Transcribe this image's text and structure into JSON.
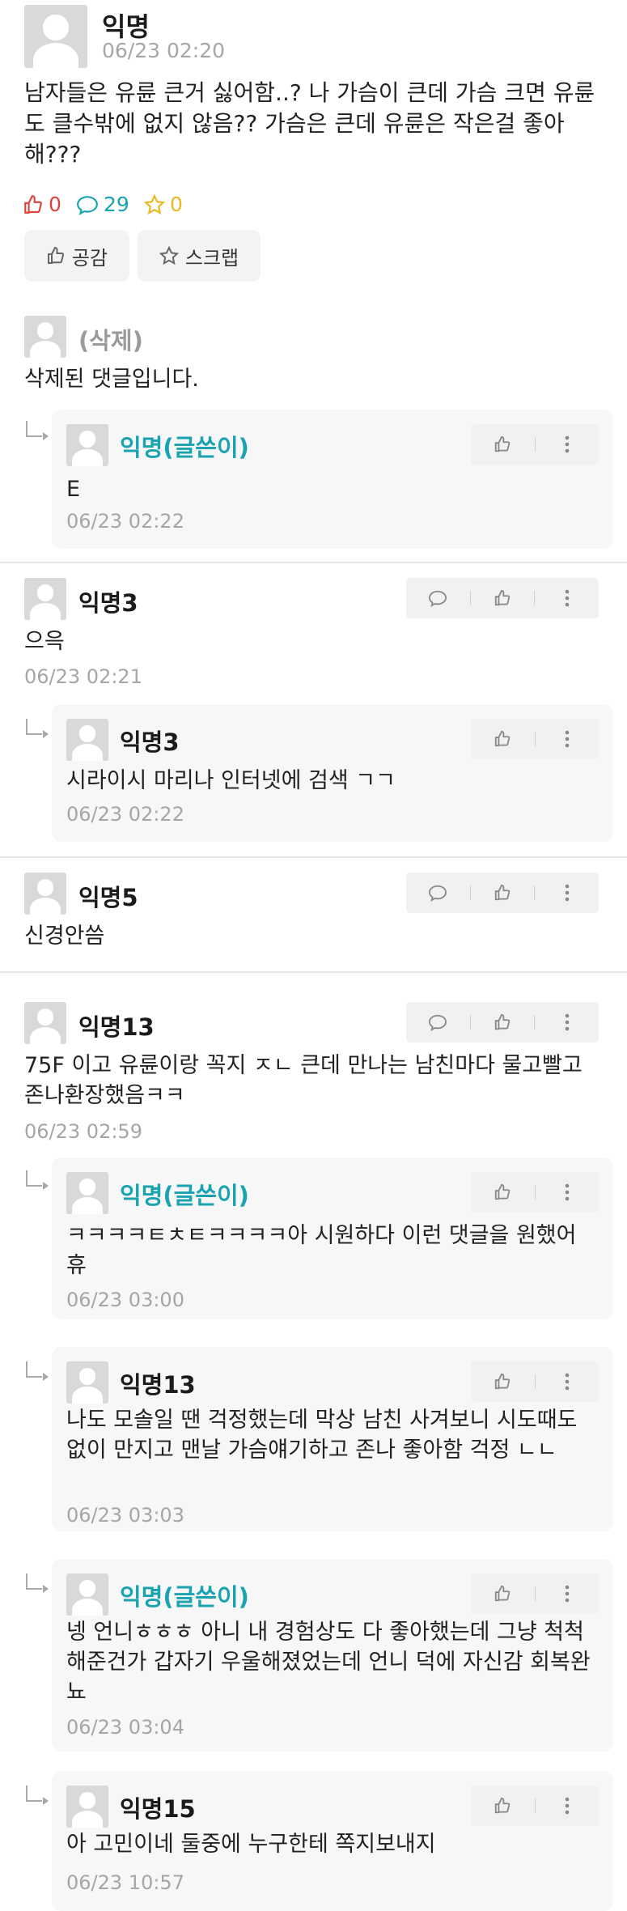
{
  "post": {
    "author": "익명",
    "date": "06/23 02:20",
    "body": "남자들은 유륜 큰거 싫어함..? 나 가슴이 큰데 가슴 크면 유륜도 클수밖에 없지 않음?? 가슴은 큰데 유륜은 작은걸 좋아해???",
    "likes": "0",
    "comments": "29",
    "scraps": "0",
    "like_button": "공감",
    "scrap_button": "스크랩"
  },
  "colors": {
    "like": "#d9453b",
    "comment": "#1aa3b0",
    "scrap": "#e8b923",
    "writer": "#1aa3b0"
  },
  "threads": [
    {
      "author": "(삭제)",
      "text": "삭제된 댓글입니다.",
      "replies": [
        {
          "author": "익명(글쓴이)",
          "text": "E",
          "date": "06/23 02:22"
        }
      ]
    },
    {
      "author": "익명3",
      "text": "으윽",
      "date": "06/23 02:21",
      "replies": [
        {
          "author": "익명3",
          "text": "시라이시 마리나 인터넷에 검색 ㄱㄱ",
          "date": "06/23 02:22"
        }
      ]
    },
    {
      "author": "익명5",
      "text": "신경안씀"
    },
    {
      "author": "익명13",
      "text": "75F 이고 유륜이랑 꼭지 ㅈㄴ 큰데 만나는 남친마다 물고빨고 존나환장했음ㅋㅋ",
      "date": "06/23 02:59",
      "replies": [
        {
          "author": "익명(글쓴이)",
          "text": "ㅋㅋㅋㅋㅌㅊㅌㅋㅋㅋㅋ아 시원하다 이런 댓글을 원했어 휴",
          "date": "06/23 03:00"
        },
        {
          "author": "익명13",
          "text": "나도 모솔일 땐 걱정했는데 막상 남친 사겨보니 시도때도없이 만지고 맨날 가슴얘기하고 존나 좋아함 걱정 ㄴㄴ",
          "date": "06/23 03:03"
        },
        {
          "author": "익명(글쓴이)",
          "text": "넹 언니ㅎㅎㅎ 아니 내 경험상도 다 좋아했는데 그냥 척척해준건가 갑자기 우울해졌었는데 언니 덕에 자신감 회복완뇨",
          "date": "06/23 03:04"
        },
        {
          "author": "익명15",
          "text": "아 고민이네 둘중에 누구한테 쪽지보내지",
          "date": "06/23 10:57"
        }
      ]
    }
  ]
}
